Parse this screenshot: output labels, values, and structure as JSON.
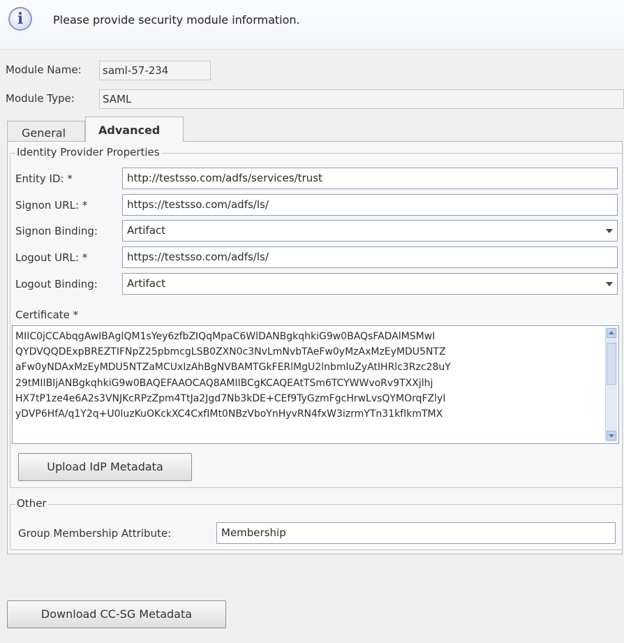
{
  "banner": {
    "message": "Please provide security module information."
  },
  "module": {
    "name_label": "Module Name:",
    "name_value": "saml-57-234",
    "type_label": "Module Type:",
    "type_value": "SAML"
  },
  "tabs": [
    {
      "label": "General",
      "selected": false
    },
    {
      "label": "Advanced",
      "selected": true
    }
  ],
  "idp": {
    "legend": "Identity Provider Properties",
    "entity_id_label": "Entity ID: *",
    "entity_id_value": "http://testsso.com/adfs/services/trust",
    "signon_url_label": "Signon URL: *",
    "signon_url_value": "https://testsso.com/adfs/ls/",
    "signon_binding_label": "Signon Binding:",
    "signon_binding_value": "Artifact",
    "logout_url_label": "Logout URL: *",
    "logout_url_value": "https://testsso.com/adfs/ls/",
    "logout_binding_label": "Logout Binding:",
    "logout_binding_value": "Artifact",
    "certificate_label": "Certificate *",
    "certificate_lines": [
      "MIIC0jCCAbqgAwIBAgIQM1sYey6zfbZIQqMpaC6WlDANBgkqhkiG9w0BAQsFADAlMSMwI",
      "QYDVQQDExpBREZTIFNpZ25pbmcgLSB0ZXN0c3NvLmNvbTAeFw0yMzAxMzEyMDU5NTZ",
      "aFw0yNDAxMzEyMDU5NTZaMCUxIzAhBgNVBAMTGkFERlMgU2lnbmluZyAtIHRlc3Rzc28uY",
      "29tMIIBIjANBgkqhkiG9w0BAQEFAAOCAQ8AMIIBCgKCAQEAtTSm6TCYWWvoRv9TXXjlhj",
      "HX7tP1ze4e6A2s3VNJKcRPzZpm4TtJa2Jgd7Nb3kDE+CEf9TyGzmFgcHrwLvsQYMOrqFZlyl",
      "yDVP6HfA/q1Y2q+U0luzKuOKckXC4CxfIMt0NBzVboYnHyvRN4fxW3izrmYTn31kfIkmTMX"
    ],
    "upload_button": "Upload IdP Metadata"
  },
  "other": {
    "legend": "Other",
    "group_membership_label": "Group Membership Attribute:",
    "group_membership_value": "Membership"
  },
  "download_button": "Download CC-SG Metadata"
}
